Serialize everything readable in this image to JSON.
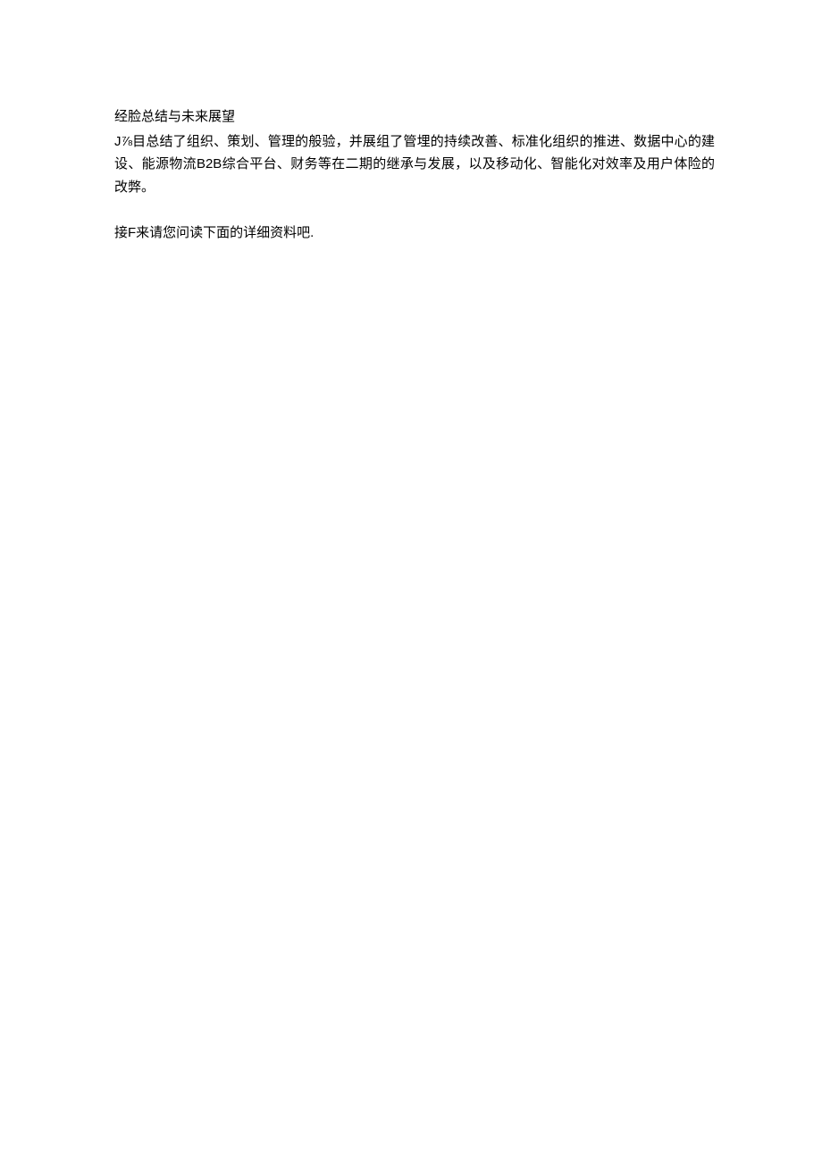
{
  "heading": "经脸总结与未来展望",
  "paragraph1": "J⅞目总结了组织、策划、管理的般验，并展组了管埋的持续改善、标准化组织的推进、数据中心的建设、能源物流B2B综合平台、财务等在二期的继承与发展，以及移动化、智能化对效率及用户体险的改弊。",
  "paragraph2": "接F来请您问读下面的详细资料吧."
}
